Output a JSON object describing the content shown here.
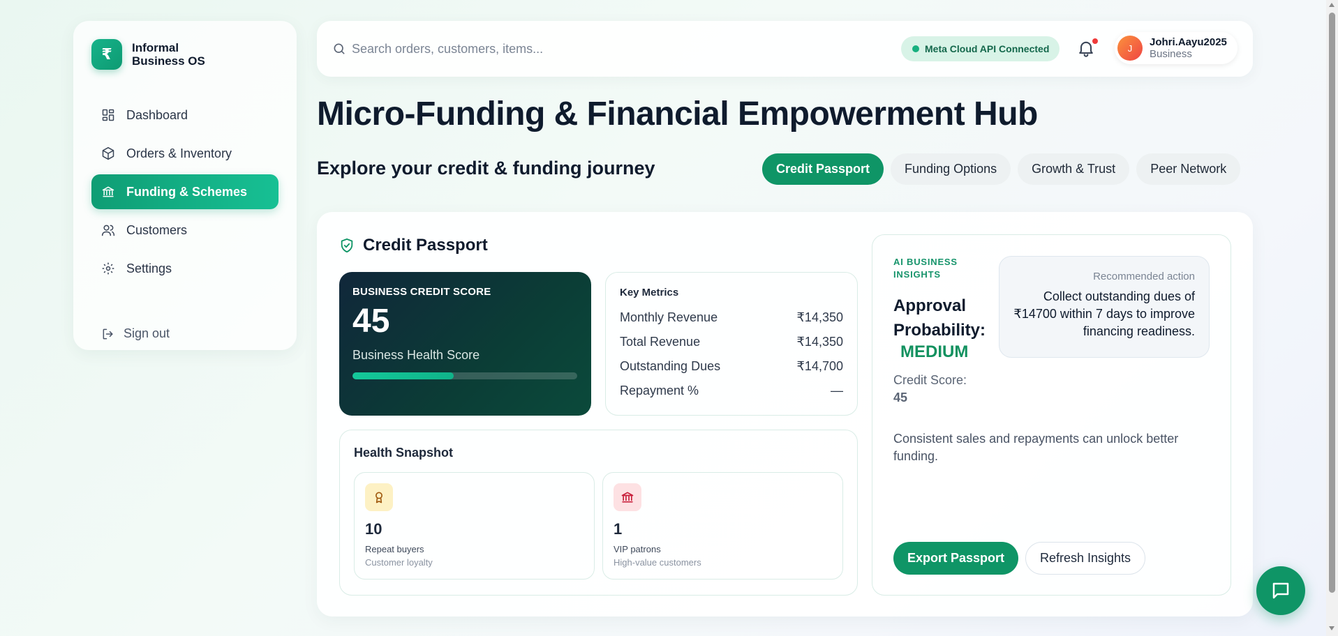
{
  "brand": {
    "logo_symbol": "₹",
    "name": "Informal Business OS"
  },
  "sidebar": {
    "items": [
      {
        "label": "Dashboard",
        "icon": "dashboard-grid-icon",
        "active": false
      },
      {
        "label": "Orders & Inventory",
        "icon": "box-icon",
        "active": false
      },
      {
        "label": "Funding & Schemes",
        "icon": "bank-icon",
        "active": true
      },
      {
        "label": "Customers",
        "icon": "users-icon",
        "active": false
      },
      {
        "label": "Settings",
        "icon": "gear-icon",
        "active": false
      }
    ],
    "signout_label": "Sign out"
  },
  "topbar": {
    "search_placeholder": "Search orders, customers, items...",
    "api_status": "Meta Cloud API Connected",
    "api_status_color": "#17b07f",
    "notification_dot_color": "#ef3a3a",
    "user": {
      "initial": "J",
      "name": "Johri.Aayu2025",
      "role": "Business"
    }
  },
  "page": {
    "title": "Micro-Funding & Financial Empowerment Hub",
    "subtitle": "Explore your credit & funding journey",
    "tabs": [
      {
        "label": "Credit Passport",
        "active": true
      },
      {
        "label": "Funding Options",
        "active": false
      },
      {
        "label": "Growth & Trust",
        "active": false
      },
      {
        "label": "Peer Network",
        "active": false
      }
    ]
  },
  "credit_passport": {
    "title": "Credit Passport",
    "score_card": {
      "label": "BUSINESS CREDIT SCORE",
      "value": "45",
      "sub": "Business Health Score",
      "progress": 0.45
    },
    "metrics": {
      "title": "Key Metrics",
      "rows": [
        {
          "label": "Monthly Revenue",
          "value": "₹14,350"
        },
        {
          "label": "Total Revenue",
          "value": "₹14,350"
        },
        {
          "label": "Outstanding Dues",
          "value": "₹14,700"
        },
        {
          "label": "Repayment %",
          "value": "—"
        }
      ]
    },
    "health": {
      "title": "Health Snapshot",
      "items": [
        {
          "value": "10",
          "label": "Repeat buyers",
          "sub": "Customer loyalty",
          "icon": "award-ribbon-icon",
          "bg": "#fdf1c4",
          "fg": "#a05a10"
        },
        {
          "value": "1",
          "label": "VIP patrons",
          "sub": "High-value customers",
          "icon": "bank-building-icon",
          "bg": "#fde1e3",
          "fg": "#c81e3a"
        }
      ]
    },
    "insights": {
      "label": "AI BUSINESS INSIGHTS",
      "approval_label": "Approval Probability:",
      "approval_value": "MEDIUM",
      "credit_score_label": "Credit Score:",
      "credit_score_value": "45",
      "recommended_label": "Recommended action",
      "recommended_text": "Collect outstanding dues of ₹14700 within 7 days to improve financing readiness.",
      "note": "Consistent sales and repayments can unlock better funding.",
      "export_label": "Export Passport",
      "refresh_label": "Refresh Insights"
    }
  },
  "accent_color": "#0f9566"
}
